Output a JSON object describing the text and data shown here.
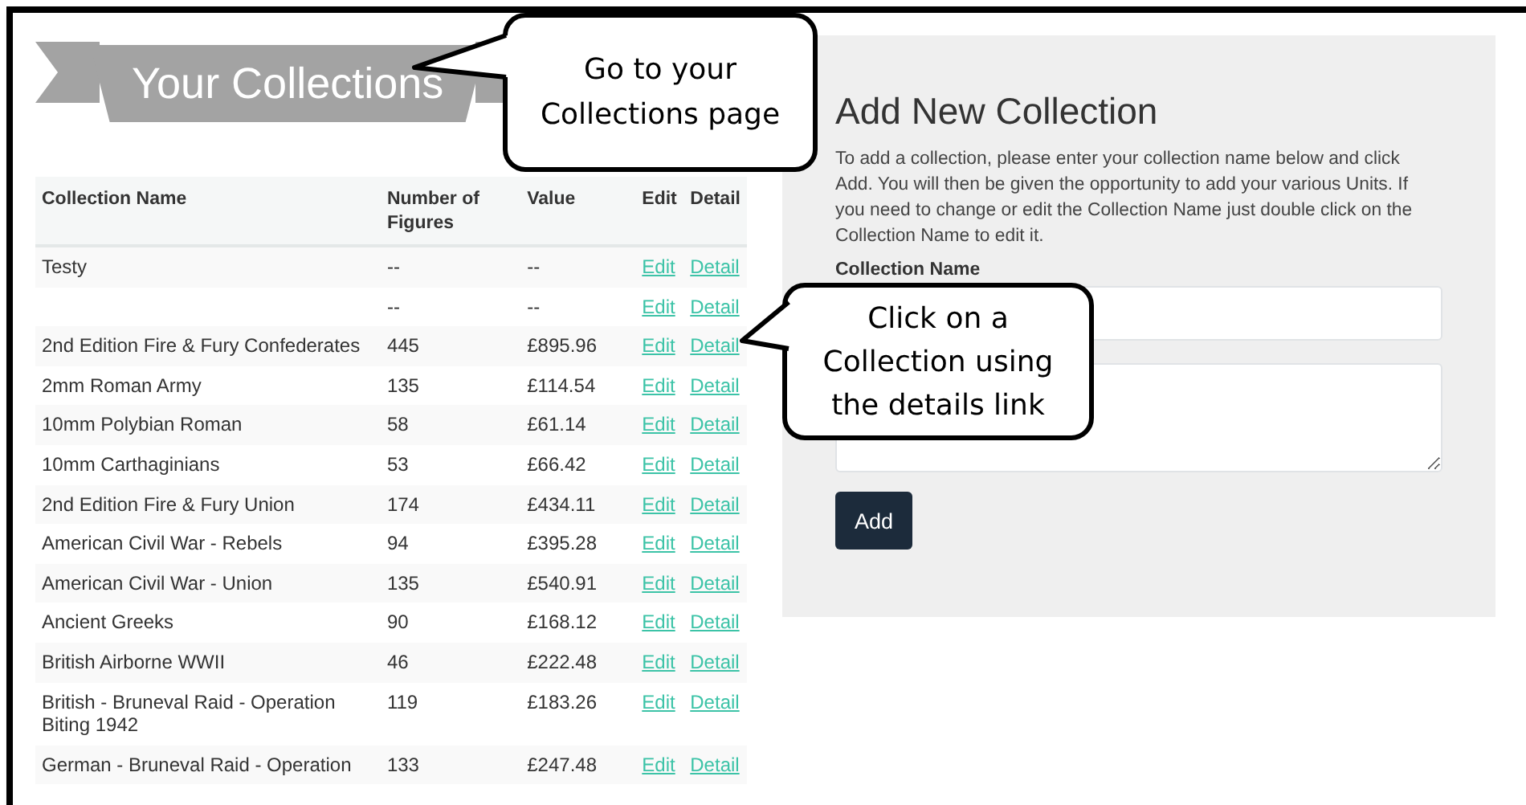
{
  "banner": {
    "title": "Your Collections"
  },
  "table": {
    "columns": [
      "Collection Name",
      "Number of Figures",
      "Value",
      "Edit",
      "Detail"
    ],
    "rows": [
      {
        "name": "Testy",
        "figures": "--",
        "value": "--",
        "edit": "Edit",
        "detail": "Detail"
      },
      {
        "figures": "--",
        "value": "--",
        "edit": "Edit",
        "detail": "Detail"
      },
      {
        "name": "2nd Edition Fire & Fury Confederates",
        "figures": "445",
        "value": "£895.96",
        "edit": "Edit",
        "detail": "Detail"
      },
      {
        "name": "2mm Roman Army",
        "figures": "135",
        "value": "£114.54",
        "edit": "Edit",
        "detail": "Detail"
      },
      {
        "name": "10mm Polybian Roman",
        "figures": "58",
        "value": "£61.14",
        "edit": "Edit",
        "detail": "Detail"
      },
      {
        "name": "10mm Carthaginians",
        "figures": "53",
        "value": "£66.42",
        "edit": "Edit",
        "detail": "Detail"
      },
      {
        "name": "2nd Edition Fire & Fury Union",
        "figures": "174",
        "value": "£434.11",
        "edit": "Edit",
        "detail": "Detail"
      },
      {
        "name": "American Civil War - Rebels",
        "figures": "94",
        "value": "£395.28",
        "edit": "Edit",
        "detail": "Detail"
      },
      {
        "name": "American Civil War - Union",
        "figures": "135",
        "value": "£540.91",
        "edit": "Edit",
        "detail": "Detail"
      },
      {
        "name": "Ancient Greeks",
        "figures": "90",
        "value": "£168.12",
        "edit": "Edit",
        "detail": "Detail"
      },
      {
        "name": "British Airborne WWII",
        "figures": "46",
        "value": "£222.48",
        "edit": "Edit",
        "detail": "Detail"
      },
      {
        "name": "British - Bruneval Raid - Operation Biting 1942",
        "figures": "119",
        "value": "£183.26",
        "edit": "Edit",
        "detail": "Detail"
      },
      {
        "name": "German - Bruneval Raid - Operation",
        "figures": "133",
        "value": "£247.48",
        "edit": "Edit",
        "detail": "Detail"
      }
    ]
  },
  "add_panel": {
    "title": "Add New Collection",
    "description": "To add a collection, please enter your collection name below and click Add. You will then be given the opportunity to add your various Units. If you need to change or edit the Collection Name just double click on the Collection Name to edit it.",
    "field_label": "Collection Name",
    "button": "Add"
  },
  "callouts": [
    "Go to your Collections page",
    "Click on a Collection using the details link"
  ]
}
